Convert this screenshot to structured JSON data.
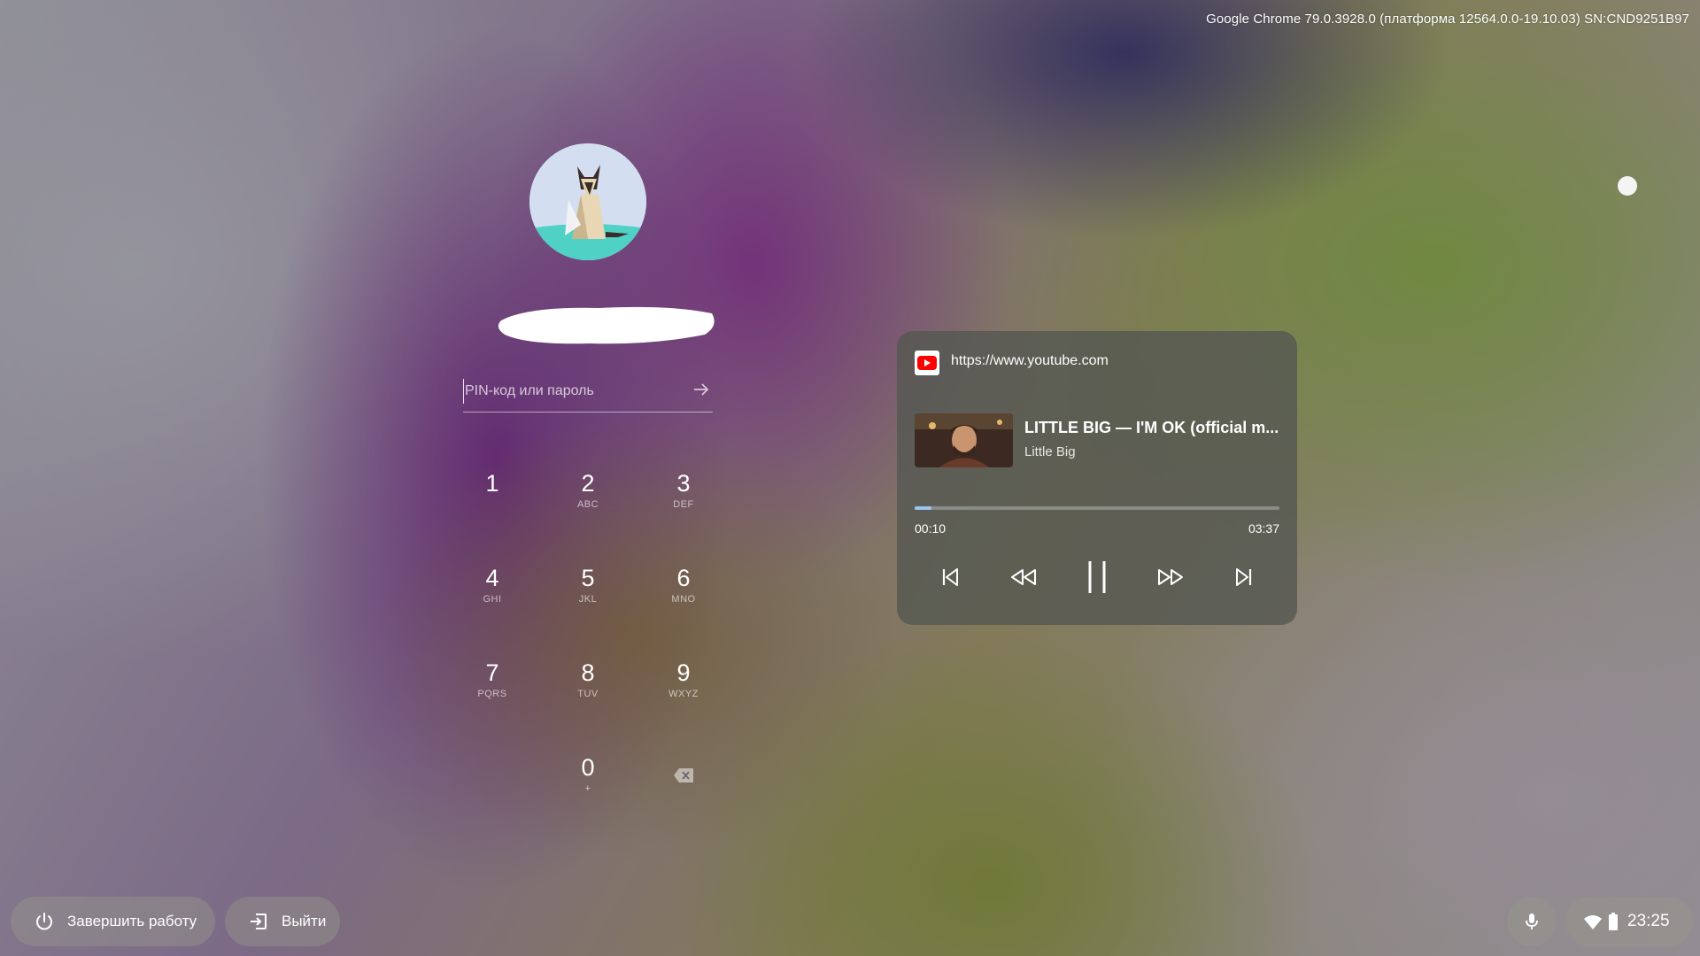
{
  "system": {
    "version_label": "Google Chrome 79.0.3928.0 (платформа 12564.0.0-19.10.03) SN:CND9251B97"
  },
  "login": {
    "password_placeholder": "PIN-код или пароль"
  },
  "keypad": {
    "keys": [
      {
        "digit": "1",
        "letters": ""
      },
      {
        "digit": "2",
        "letters": "ABC"
      },
      {
        "digit": "3",
        "letters": "DEF"
      },
      {
        "digit": "4",
        "letters": "GHI"
      },
      {
        "digit": "5",
        "letters": "JKL"
      },
      {
        "digit": "6",
        "letters": "MNO"
      },
      {
        "digit": "7",
        "letters": "PQRS"
      },
      {
        "digit": "8",
        "letters": "TUV"
      },
      {
        "digit": "9",
        "letters": "WXYZ"
      },
      {
        "digit": "0",
        "letters": "+"
      }
    ],
    "backspace_icon": "backspace-icon"
  },
  "media": {
    "source_url": "https://www.youtube.com",
    "source_icon": "youtube-icon",
    "title": "LITTLE BIG — I'M OK (official m...",
    "artist": "Little Big",
    "elapsed": "00:10",
    "total": "03:37",
    "progress_fraction": 0.046,
    "accent_color": "#9cc3f2",
    "controls": [
      "previous-track-icon",
      "rewind-icon",
      "pause-icon",
      "fast-forward-icon",
      "next-track-icon"
    ]
  },
  "shelf": {
    "shutdown_label": "Завершить работу",
    "signout_label": "Выйти",
    "clock": "23:25"
  },
  "colors": {
    "youtube_red": "#ff0000",
    "card_bg": "#565852",
    "avatar_teal": "#4fd1c5"
  }
}
